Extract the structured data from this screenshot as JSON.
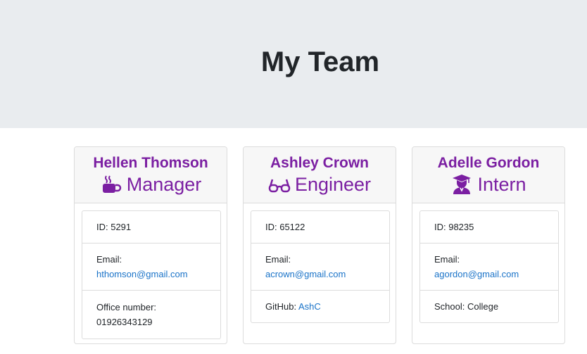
{
  "header": {
    "title": "My Team"
  },
  "colors": {
    "accent": "#7b1fa2",
    "link": "#1a73c8",
    "jumbotron": "#e9ecef"
  },
  "cards": [
    {
      "name": "Hellen Thomson",
      "role": "Manager",
      "icon": "coffee-mug-icon",
      "id_label": "ID: 5291",
      "email_label": "Email:",
      "email": "hthomson@gmail.com",
      "extra_label": "Office number:",
      "extra_value": "01926343129"
    },
    {
      "name": "Ashley Crown",
      "role": "Engineer",
      "icon": "glasses-icon",
      "id_label": "ID: 65122",
      "email_label": "Email:",
      "email": "acrown@gmail.com",
      "extra_label": "GitHub:",
      "extra_value": "AshC"
    },
    {
      "name": "Adelle Gordon",
      "role": "Intern",
      "icon": "graduate-icon",
      "id_label": "ID: 98235",
      "email_label": "Email:",
      "email": "agordon@gmail.com",
      "extra_label": "School: College"
    }
  ]
}
